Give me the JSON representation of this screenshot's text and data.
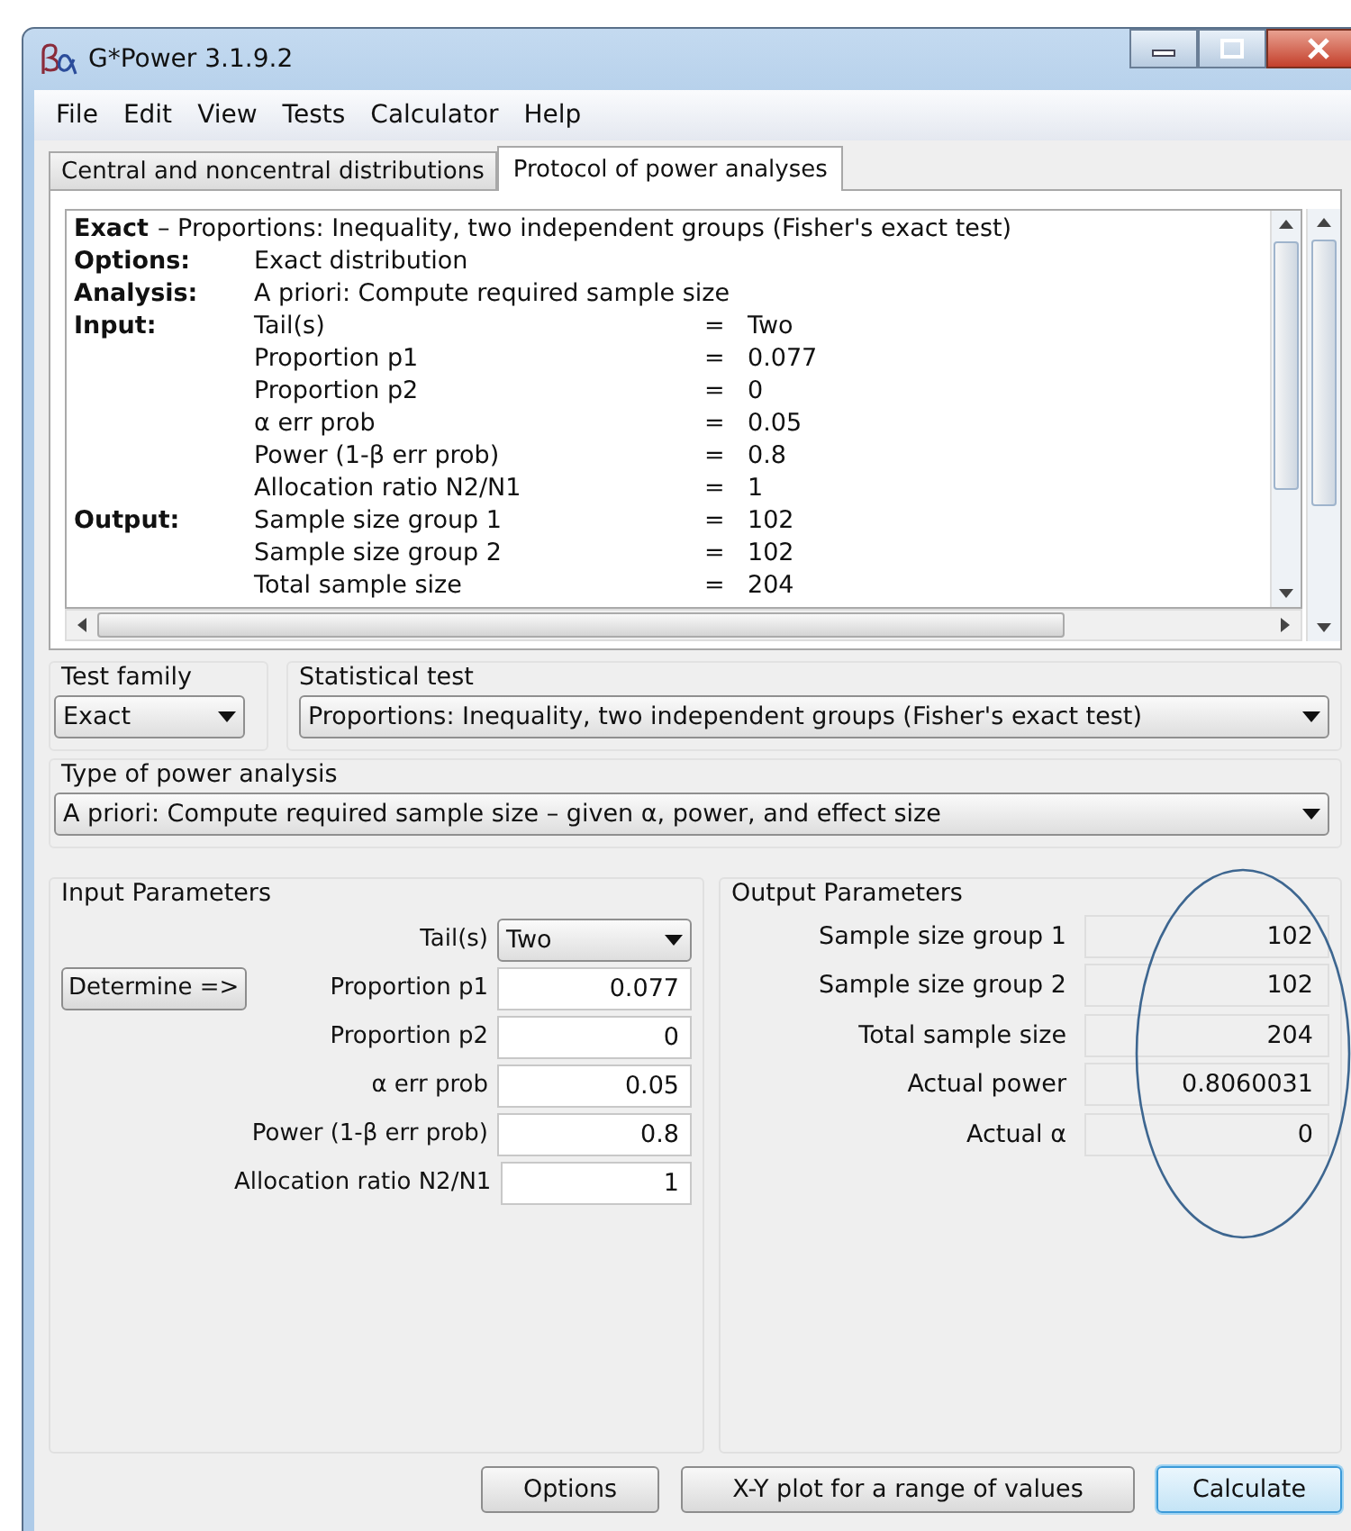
{
  "window": {
    "title": "G*Power 3.1.9.2"
  },
  "menu": [
    "File",
    "Edit",
    "View",
    "Tests",
    "Calculator",
    "Help"
  ],
  "tabs": [
    {
      "label": "Central and noncentral distributions",
      "selected": false
    },
    {
      "label": "Protocol of power analyses",
      "selected": true
    }
  ],
  "protocol": {
    "head_bold": "Exact",
    "head_rest": "– Proportions: Inequality, two independent groups (Fisher's exact test)",
    "sections": [
      {
        "label": "Options:",
        "rows": [
          {
            "name": "Exact distribution"
          }
        ]
      },
      {
        "label": "Analysis:",
        "rows": [
          {
            "name": "A priori: Compute required sample size"
          }
        ]
      },
      {
        "label": "Input:",
        "rows": [
          {
            "name": "Tail(s)",
            "equals": "=",
            "value": "Two"
          },
          {
            "name": "Proportion p1",
            "equals": "=",
            "value": "0.077"
          },
          {
            "name": "Proportion p2",
            "equals": "=",
            "value": "0"
          },
          {
            "name": "α err prob",
            "equals": "=",
            "value": "0.05"
          },
          {
            "name": "Power (1-β err prob)",
            "equals": "=",
            "value": "0.8"
          },
          {
            "name": "Allocation ratio N2/N1",
            "equals": "=",
            "value": "1"
          }
        ]
      },
      {
        "label": "Output:",
        "rows": [
          {
            "name": "Sample size group 1",
            "equals": "=",
            "value": "102"
          },
          {
            "name": "Sample size group 2",
            "equals": "=",
            "value": "102"
          },
          {
            "name": "Total sample size",
            "equals": "=",
            "value": "204"
          }
        ]
      }
    ]
  },
  "test_family": {
    "legend": "Test family",
    "value": "Exact"
  },
  "statistical_test": {
    "legend": "Statistical test",
    "value": "Proportions: Inequality, two independent groups (Fisher's exact test)"
  },
  "power_analysis": {
    "legend": "Type of power analysis",
    "value": "A priori: Compute required sample size – given α, power, and effect size"
  },
  "input_parameters": {
    "legend": "Input Parameters",
    "determine": "Determine =>",
    "rows": [
      {
        "kind": "dropdown",
        "label": "Tail(s)",
        "value": "Two"
      },
      {
        "kind": "field",
        "label": "Proportion p1",
        "value": "0.077"
      },
      {
        "kind": "field",
        "label": "Proportion p2",
        "value": "0"
      },
      {
        "kind": "field",
        "label": "α err prob",
        "value": "0.05"
      },
      {
        "kind": "field",
        "label": "Power (1-β err prob)",
        "value": "0.8"
      },
      {
        "kind": "field",
        "label": "Allocation ratio N2/N1",
        "value": "1"
      }
    ]
  },
  "output_parameters": {
    "legend": "Output Parameters",
    "rows": [
      {
        "label": "Sample size group 1",
        "value": "102"
      },
      {
        "label": "Sample size group 2",
        "value": "102"
      },
      {
        "label": "Total sample size",
        "value": "204"
      },
      {
        "label": "Actual power",
        "value": "0.8060031"
      },
      {
        "label": "Actual α",
        "value": "0"
      }
    ]
  },
  "buttons": [
    {
      "label": "Options",
      "focused": false
    },
    {
      "label": "X-Y plot for a range of values",
      "focused": false
    },
    {
      "label": "Calculate",
      "focused": true
    }
  ]
}
